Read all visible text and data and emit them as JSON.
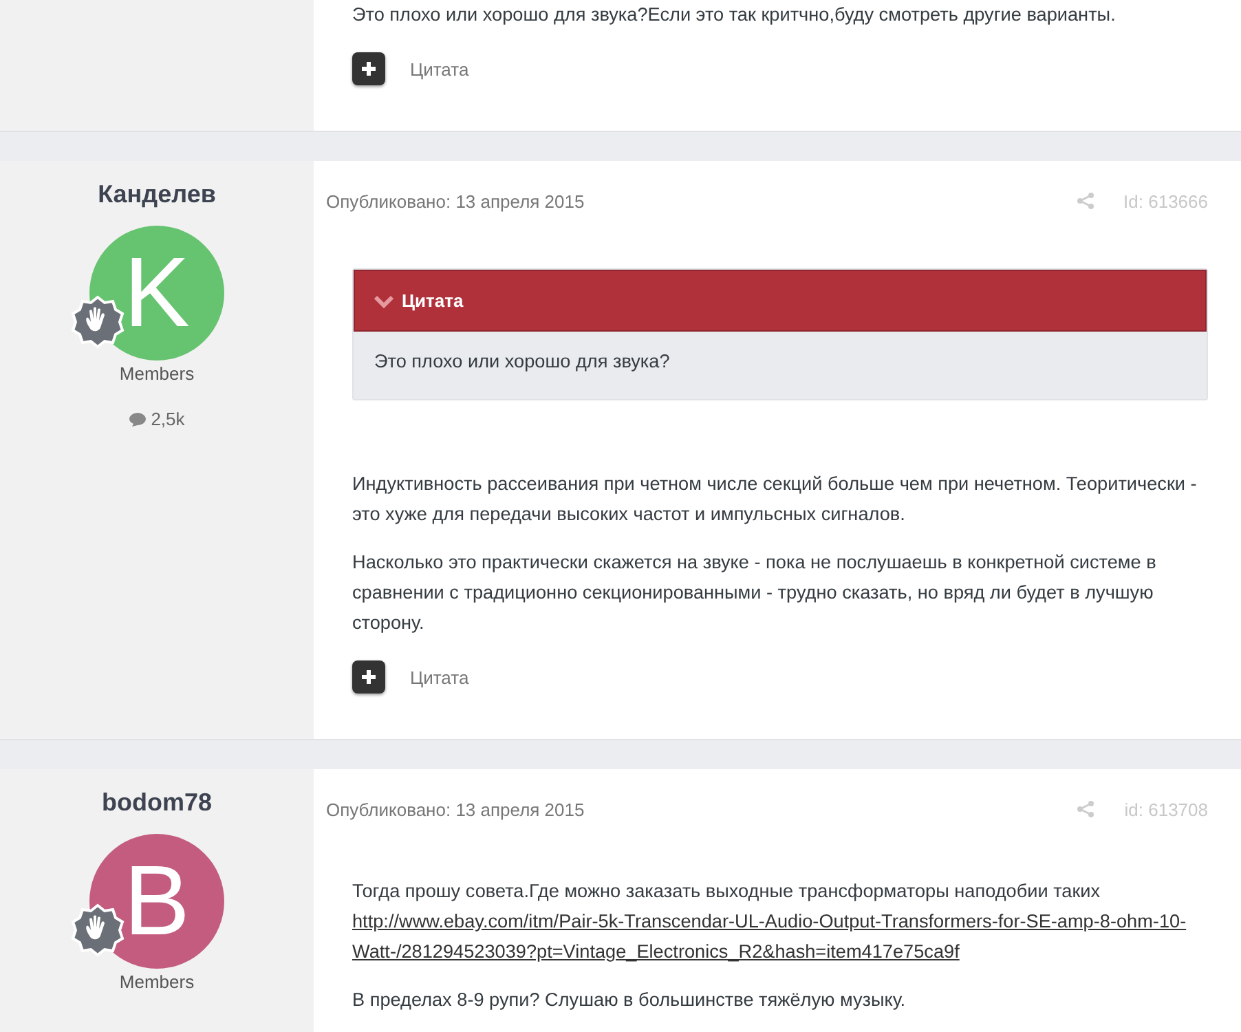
{
  "posts": [
    {
      "body": [
        {
          "kind": "paragraph",
          "text": "Это плохо или хорошо для звука?Если это так критчно,буду смотреть другие варианты."
        }
      ],
      "quote_button": "Цитата"
    },
    {
      "author": {
        "name": "Канделев",
        "avatar_letter": "K",
        "color": "#66c370",
        "group": "Members",
        "post_count": "2,5k"
      },
      "date": "Опубликовано: 13 апреля 2015",
      "id": "Id: 613666",
      "body": [
        {
          "kind": "quote",
          "title": "Цитата",
          "text": "Это плохо или хорошо для звука?"
        },
        {
          "kind": "paragraph",
          "text": "Индуктивность рассеивания при четном числе секций больше чем при нечетном. Теоритически - это хуже для передачи высоких частот и импульсных сигналов."
        },
        {
          "kind": "paragraph",
          "text": "Насколько это практически скажется на звуке - пока не послушаешь в конкретной системе в сравнении с традиционно секционированными - трудно сказать, но вряд ли будет в лучшую сторону."
        }
      ],
      "quote_button": "Цитата"
    },
    {
      "author": {
        "name": "bodom78",
        "avatar_letter": "B",
        "color": "#c45c80",
        "group": "Members"
      },
      "date": "Опубликовано: 13 апреля 2015",
      "id": "id: 613708",
      "body": [
        {
          "kind": "link_paragraph",
          "text": "Тогда прошу совета.Где можно заказать выходные трансформаторы наподобии таких",
          "link": "http://www.ebay.com/itm/Pair-5k-Transcendar-UL-Audio-Output-Transformers-for-SE-amp-8-ohm-10-Watt-/281294523039?pt=Vintage_Electronics_R2&hash=item417e75ca9f"
        },
        {
          "kind": "paragraph",
          "text": "В пределах 8-9 рупи? Слушаю в большинстве тяжёлую музыку."
        }
      ]
    }
  ]
}
